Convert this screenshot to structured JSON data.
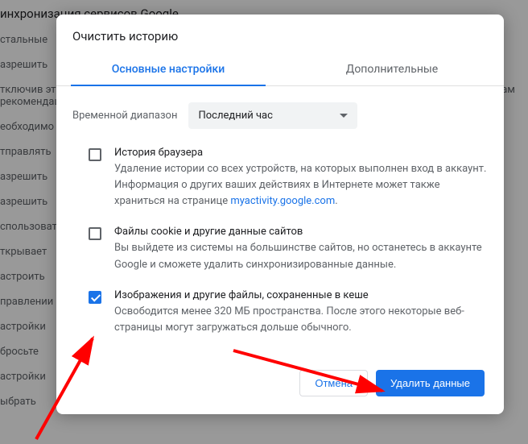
{
  "background": {
    "head": "инхронизация сервисов Google",
    "rows": [
      "стальные",
      "азрешить",
      "тключив эту функцию, вы не будете получать никаких подсказок. Google Chrome может отправлять вам рекомендации",
      "еобходимо",
      "тправлять",
      "азрешить",
      "азрешить",
      "спользовать",
      "ткрывает",
      "астроить",
      "правлении",
      "астройки",
      "бросьте",
      "астройки",
      "ыбрать"
    ]
  },
  "dialog": {
    "title": "Очистить историю",
    "tabs": {
      "basic": "Основные настройки",
      "advanced": "Дополнительные"
    },
    "range": {
      "label": "Временной диапазон",
      "value": "Последний час"
    },
    "options": [
      {
        "checked": false,
        "title": "История браузера",
        "desc_pre": "Удаление истории со всех устройств, на которых выполнен вход в аккаунт. Информация о других ваших действиях в Интернете может также храниться на странице ",
        "link": "myactivity.google.com",
        "desc_post": "."
      },
      {
        "checked": false,
        "title": "Файлы cookie и другие данные сайтов",
        "desc": "Вы выйдете из системы на большинстве сайтов, но останетесь в аккаунте Google и сможете удалить синхронизированные данные."
      },
      {
        "checked": true,
        "title": "Изображения и другие файлы, сохраненные в кеше",
        "desc": "Освободится менее 320 МБ пространства. После этого некоторые веб-страницы могут загружаться дольше обычного."
      }
    ],
    "buttons": {
      "cancel": "Отмена",
      "confirm": "Удалить данные"
    }
  }
}
